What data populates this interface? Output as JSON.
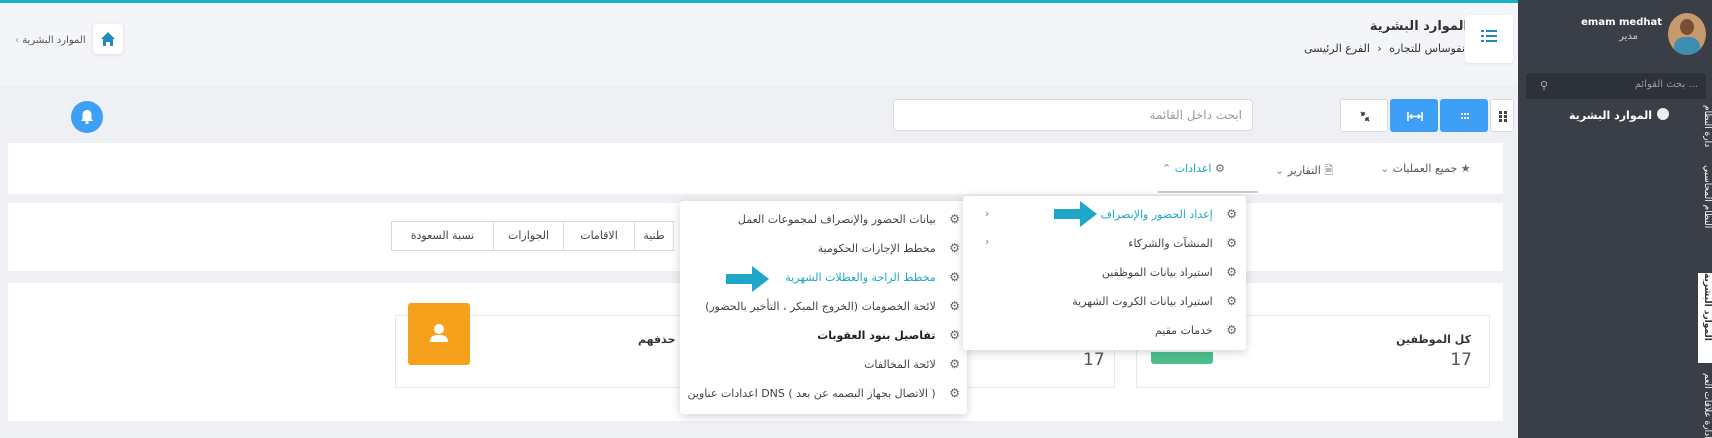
{
  "sidebar": {
    "user_name": "emam medhat",
    "user_role": "مدير",
    "search_placeholder": "بحث القوائم ...",
    "menu_item": "الموارد البشرية",
    "vertical_tabs": [
      "دارة النظام",
      "النظام المحاسبي",
      "الموارد البشرية",
      "ادارة علاقات العم"
    ]
  },
  "header": {
    "title": "الموارد البشرية",
    "company": "انفوساس للتجاره",
    "branch": "الفرع الرئيسى",
    "home_crumb": "الموارد البشرية"
  },
  "toolbar": {
    "search_placeholder": "ابحث داخل القائمة"
  },
  "tabs": {
    "all_operations": "جميع العمليات",
    "reports": "التقارير",
    "settings": "اعدادات"
  },
  "subtabs": [
    "نسبة السعودة",
    "الجوازات",
    "الاقامات",
    "طنية"
  ],
  "cards": {
    "all_employees_title": "كل الموظفين",
    "all_employees_value": "17",
    "middle_value": "17",
    "deleted_title": "م حذفهم"
  },
  "dropdown_main": {
    "items": [
      {
        "label": "إعداد الحضور والإنصراف",
        "active": true,
        "has_sub": true
      },
      {
        "label": "المنشآت والشركاء",
        "active": false,
        "has_sub": true
      },
      {
        "label": "استيراد بيانات الموظفين",
        "active": false,
        "has_sub": false
      },
      {
        "label": "استيراد بيانات الكروت الشهرية",
        "active": false,
        "has_sub": false
      },
      {
        "label": "خدمات مقيم",
        "active": false,
        "has_sub": false
      }
    ]
  },
  "dropdown_sub": {
    "items": [
      {
        "label": "بيانات الحضور والإنصراف لمجموعات العمل",
        "style": "normal"
      },
      {
        "label": "مخطط الإجازات الحكومية",
        "style": "normal"
      },
      {
        "label": "مخطط الراحة والعطلات الشهرية",
        "style": "active"
      },
      {
        "label": "لائحة الخصومات (الخروج المبكر ، التأخير بالحضور)",
        "style": "normal"
      },
      {
        "label": "تفاصيل بنود العقوبات",
        "style": "bold"
      },
      {
        "label": "لائحة المخالفات",
        "style": "normal"
      },
      {
        "label": "اعدادات عناوين DNS ( الاتصال بجهاز البصمه عن بعد )",
        "style": "normal"
      }
    ]
  },
  "colors": {
    "accent": "#3d9ff5",
    "highlight": "#1ea7c9",
    "orange": "#f5a11c",
    "green": "#4cbf8c"
  }
}
